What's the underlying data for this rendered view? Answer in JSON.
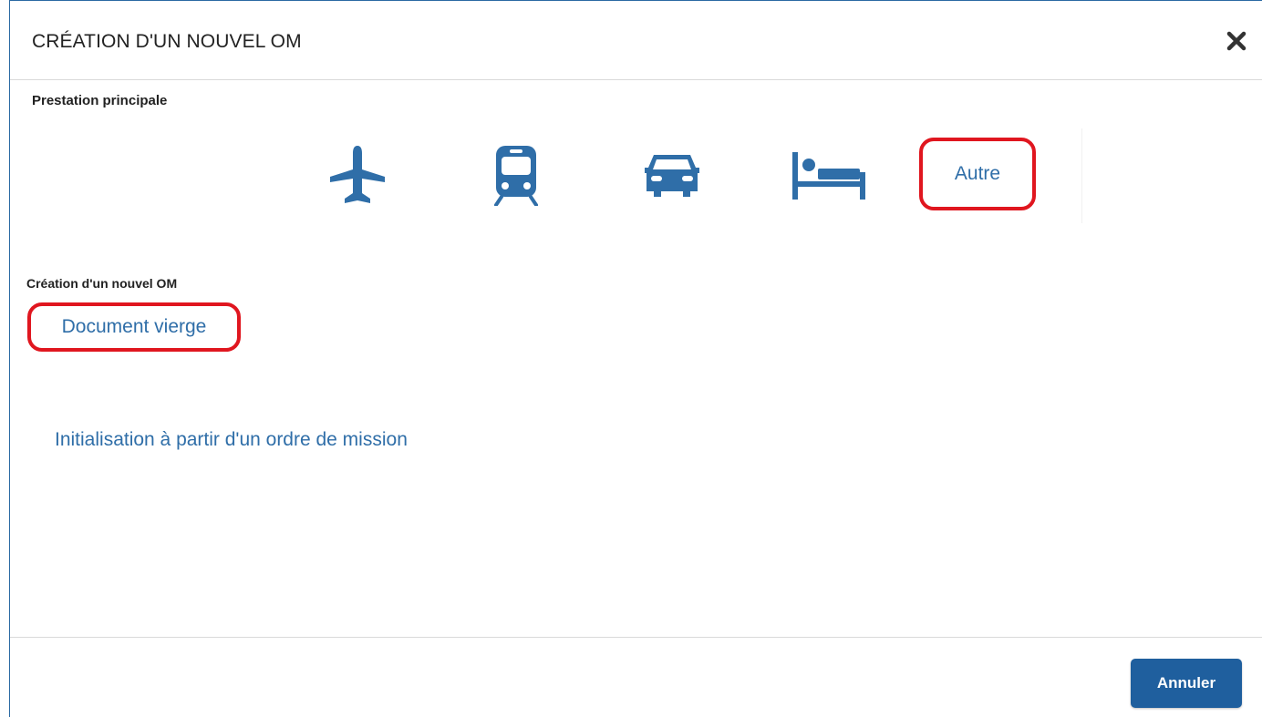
{
  "dialog": {
    "title": "CRÉATION D'UN NOUVEL OM",
    "close_icon": "close-icon"
  },
  "prestation": {
    "label": "Prestation principale",
    "options": [
      {
        "icon": "plane-icon"
      },
      {
        "icon": "train-icon"
      },
      {
        "icon": "car-icon"
      },
      {
        "icon": "hotel-bed-icon"
      },
      {
        "label": "Autre"
      }
    ]
  },
  "creation": {
    "label": "Création d'un nouvel OM",
    "blank_document": "Document vierge",
    "init_from_order": "Initialisation à partir d'un ordre de mission"
  },
  "footer": {
    "cancel_label": "Annuler"
  },
  "colors": {
    "accent": "#2f6ea8",
    "highlight": "#e0161f",
    "button": "#1f5f9e"
  }
}
